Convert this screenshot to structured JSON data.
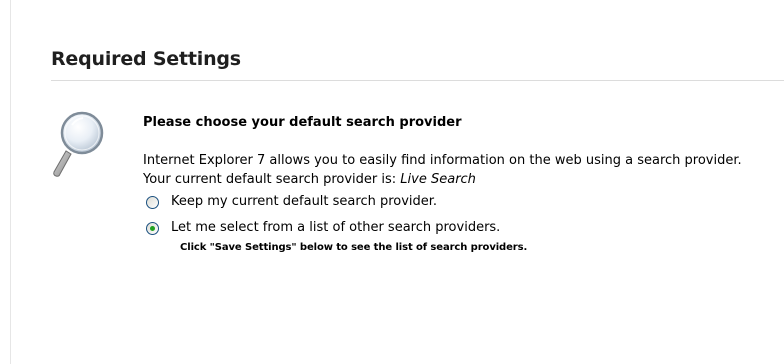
{
  "top_mark": "ˇ",
  "section": {
    "title": "Required Settings"
  },
  "icons": {
    "main": "magnifier-icon"
  },
  "search_provider": {
    "question": "Please choose your default search provider",
    "description": "Internet Explorer 7 allows you to easily find information on the web using a search provider.",
    "current_prefix": "Your current default search provider is: ",
    "current_value": "Live Search",
    "options": [
      {
        "label": "Keep my current default search provider.",
        "checked": false
      },
      {
        "label": "Let me select from a list of other search providers.",
        "checked": true
      }
    ],
    "hint": "Click \"Save Settings\" below to see the list of search providers."
  },
  "colors": {
    "radio_border": "#1c5180",
    "radio_dot": "#21a121",
    "rule": "#dcdcdc"
  }
}
